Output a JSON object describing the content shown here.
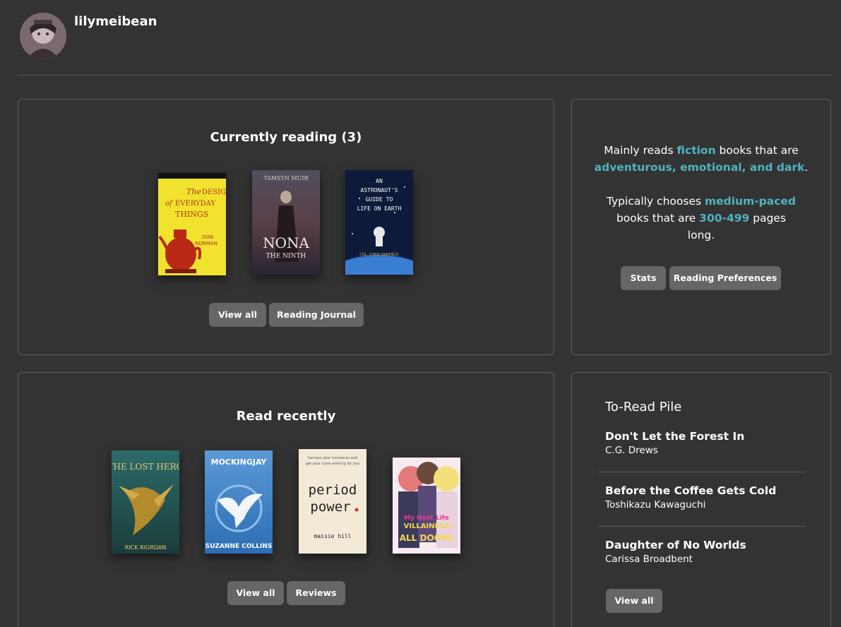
{
  "profile": {
    "username": "lilymeibean",
    "avatar_icon": "avatar-image"
  },
  "currently_reading": {
    "title": "Currently reading (3)",
    "books": [
      {
        "cover_title": "The DESIGN of EVERYDAY THINGS",
        "cover_author": "DON NORMAN"
      },
      {
        "cover_title": "NONA THE NINTH",
        "cover_author": "TAMSYN MUIR"
      },
      {
        "cover_title": "AN ASTRONAUT'S GUIDE TO LIFE ON EARTH",
        "cover_author": "COL. CHRIS HADFIELD"
      }
    ],
    "view_all_label": "View all",
    "journal_label": "Reading Journal"
  },
  "stats": {
    "line1_pre": "Mainly reads ",
    "genre": "fiction",
    "line1_mid": " books that are ",
    "moods": "adventurous, emotional, and dark",
    "line1_end": ".",
    "line2_pre": "Typically chooses ",
    "pace": "medium-paced",
    "line2_mid": " books that are ",
    "pages": "300-499",
    "line2_end": " pages long.",
    "stats_label": "Stats",
    "prefs_label": "Reading Preferences",
    "accent_color": "#4fb3bf"
  },
  "read_recently": {
    "title": "Read recently",
    "books": [
      {
        "cover_title": "THE LOST HERO",
        "cover_author": "RICK RIORDAN"
      },
      {
        "cover_title": "MOCKINGJAY",
        "cover_author": "SUZANNE COLLINS"
      },
      {
        "cover_title": "period power.",
        "cover_author": "maisie hill"
      },
      {
        "cover_title": "My Next Life as a VILLAINESS: ALL ROUTES LEAD TO DOOM!",
        "cover_author": ""
      }
    ],
    "view_all_label": "View all",
    "reviews_label": "Reviews"
  },
  "to_read": {
    "title": "To-Read Pile",
    "items": [
      {
        "title": "Don't Let the Forest In",
        "author": "C.G. Drews"
      },
      {
        "title": "Before the Coffee Gets Cold",
        "author": "Toshikazu Kawaguchi"
      },
      {
        "title": "Daughter of No Worlds",
        "author": "Carissa Broadbent"
      }
    ],
    "view_all_label": "View all"
  }
}
